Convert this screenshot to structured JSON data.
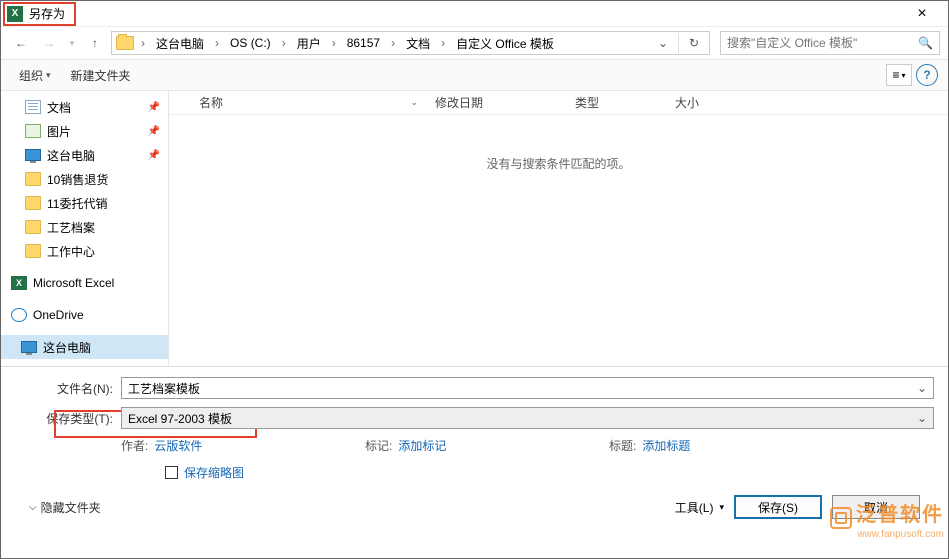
{
  "title": "另存为",
  "close_glyph": "×",
  "nav": {
    "back": "←",
    "fwd": "→",
    "fwd_dd": "▾",
    "up": "↑"
  },
  "breadcrumbs": [
    "这台电脑",
    "OS (C:)",
    "用户",
    "86157",
    "文档",
    "自定义 Office 模板"
  ],
  "bc_sep": "›",
  "addr": {
    "dd": "⌄",
    "refresh": "↻"
  },
  "search": {
    "placeholder": "搜索\"自定义 Office 模板\"",
    "icon": "🔍"
  },
  "toolbar": {
    "organize": "组织",
    "newfolder": "新建文件夹",
    "dd": "▾",
    "view_glyph": "≡",
    "help": "?"
  },
  "tree": [
    {
      "icon": "docs",
      "label": "文档",
      "pin": true
    },
    {
      "icon": "pic",
      "label": "图片",
      "pin": true
    },
    {
      "icon": "pc",
      "label": "这台电脑",
      "pin": true
    },
    {
      "icon": "fold",
      "label": "10销售退货"
    },
    {
      "icon": "fold",
      "label": "11委托代销"
    },
    {
      "icon": "fold",
      "label": "工艺档案"
    },
    {
      "icon": "fold",
      "label": "工作中心"
    },
    {
      "icon": "xl",
      "label": "Microsoft Excel",
      "spaced": true,
      "indent": 10
    },
    {
      "icon": "od",
      "label": "OneDrive",
      "spaced": true,
      "indent": 10
    },
    {
      "icon": "pc",
      "label": "这台电脑",
      "spaced": true,
      "indent": 20,
      "sel": true
    }
  ],
  "pin_glyph": "📌",
  "columns": {
    "name": "名称",
    "date": "修改日期",
    "type": "类型",
    "size": "大小",
    "sort": "⌄"
  },
  "empty_text": "没有与搜索条件匹配的项。",
  "form": {
    "filename_label": "文件名(N):",
    "filename_value": "工艺档案模板",
    "filetype_label": "保存类型(T):",
    "filetype_value": "Excel 97-2003 模板"
  },
  "meta": {
    "author_label": "作者:",
    "author_value": "云版软件",
    "tags_label": "标记:",
    "tags_value": "添加标记",
    "title_label": "标题:",
    "title_value": "添加标题"
  },
  "thumb": {
    "label": "保存缩略图"
  },
  "footer": {
    "hide": "隐藏文件夹",
    "tools": "工具(L)",
    "save": "保存(S)",
    "cancel": "取消",
    "dd": "▾",
    "chev": "⌵"
  },
  "watermark": {
    "t1": "泛普软件",
    "t2": "www.fanpusoft.com"
  }
}
